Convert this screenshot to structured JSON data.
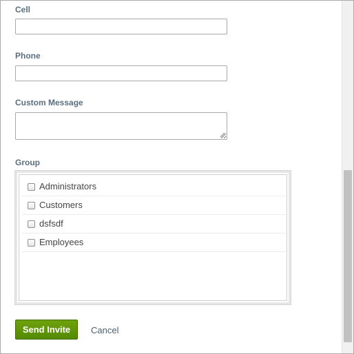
{
  "form": {
    "cell": {
      "label": "Cell",
      "value": ""
    },
    "phone": {
      "label": "Phone",
      "value": ""
    },
    "custom_message": {
      "label": "Custom Message",
      "value": ""
    },
    "group": {
      "label": "Group",
      "items": [
        {
          "label": "Administrators",
          "checked": false
        },
        {
          "label": "Customers",
          "checked": false
        },
        {
          "label": "dsfsdf",
          "checked": false
        },
        {
          "label": "Employees",
          "checked": false
        }
      ]
    }
  },
  "actions": {
    "send_label": "Send Invite",
    "cancel_label": "Cancel"
  },
  "colors": {
    "primary_button": "#5f9608",
    "label_text": "#5a6e7c"
  },
  "scrollbar": {
    "visible_fraction": 0.49,
    "position_fraction": 1.0
  }
}
